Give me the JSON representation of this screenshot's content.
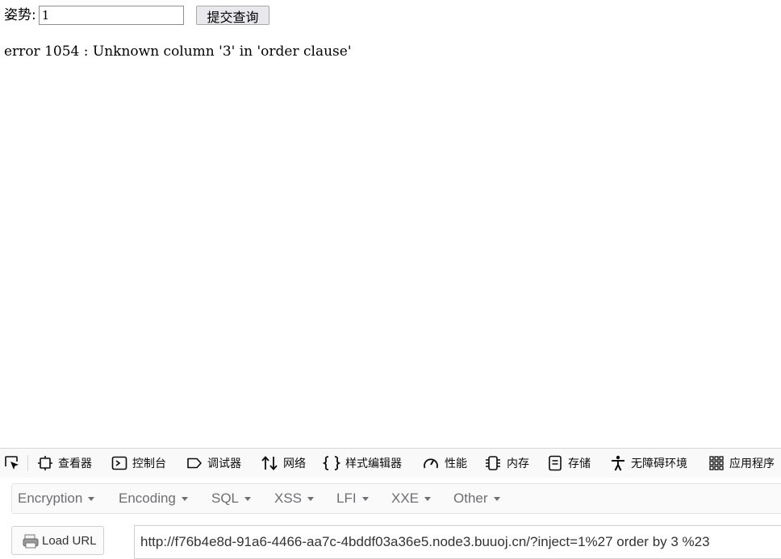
{
  "form": {
    "label": "姿势:",
    "input_value": "1",
    "submit_label": "提交查询"
  },
  "error": {
    "message": "error 1054 : Unknown column '3' in 'order clause'"
  },
  "devtools": {
    "tabs": [
      {
        "label": "查看器",
        "icon": "inspector-icon"
      },
      {
        "label": "控制台",
        "icon": "console-icon"
      },
      {
        "label": "调试器",
        "icon": "debugger-icon"
      },
      {
        "label": "网络",
        "icon": "network-icon"
      },
      {
        "label": "样式编辑器",
        "icon": "style-editor-icon"
      },
      {
        "label": "性能",
        "icon": "performance-icon"
      },
      {
        "label": "内存",
        "icon": "memory-icon"
      },
      {
        "label": "存储",
        "icon": "storage-icon"
      },
      {
        "label": "无障碍环境",
        "icon": "accessibility-icon"
      },
      {
        "label": "应用程序",
        "icon": "application-icon"
      }
    ]
  },
  "hackbar": {
    "menus": [
      "Encryption",
      "Encoding",
      "SQL",
      "XSS",
      "LFI",
      "XXE",
      "Other"
    ],
    "load_url_label": "Load URL",
    "url": "http://f76b4e8d-91a6-4466-aa7c-4bddf03a36e5.node3.buuoj.cn/?inject=1%27 order by 3 %23"
  }
}
